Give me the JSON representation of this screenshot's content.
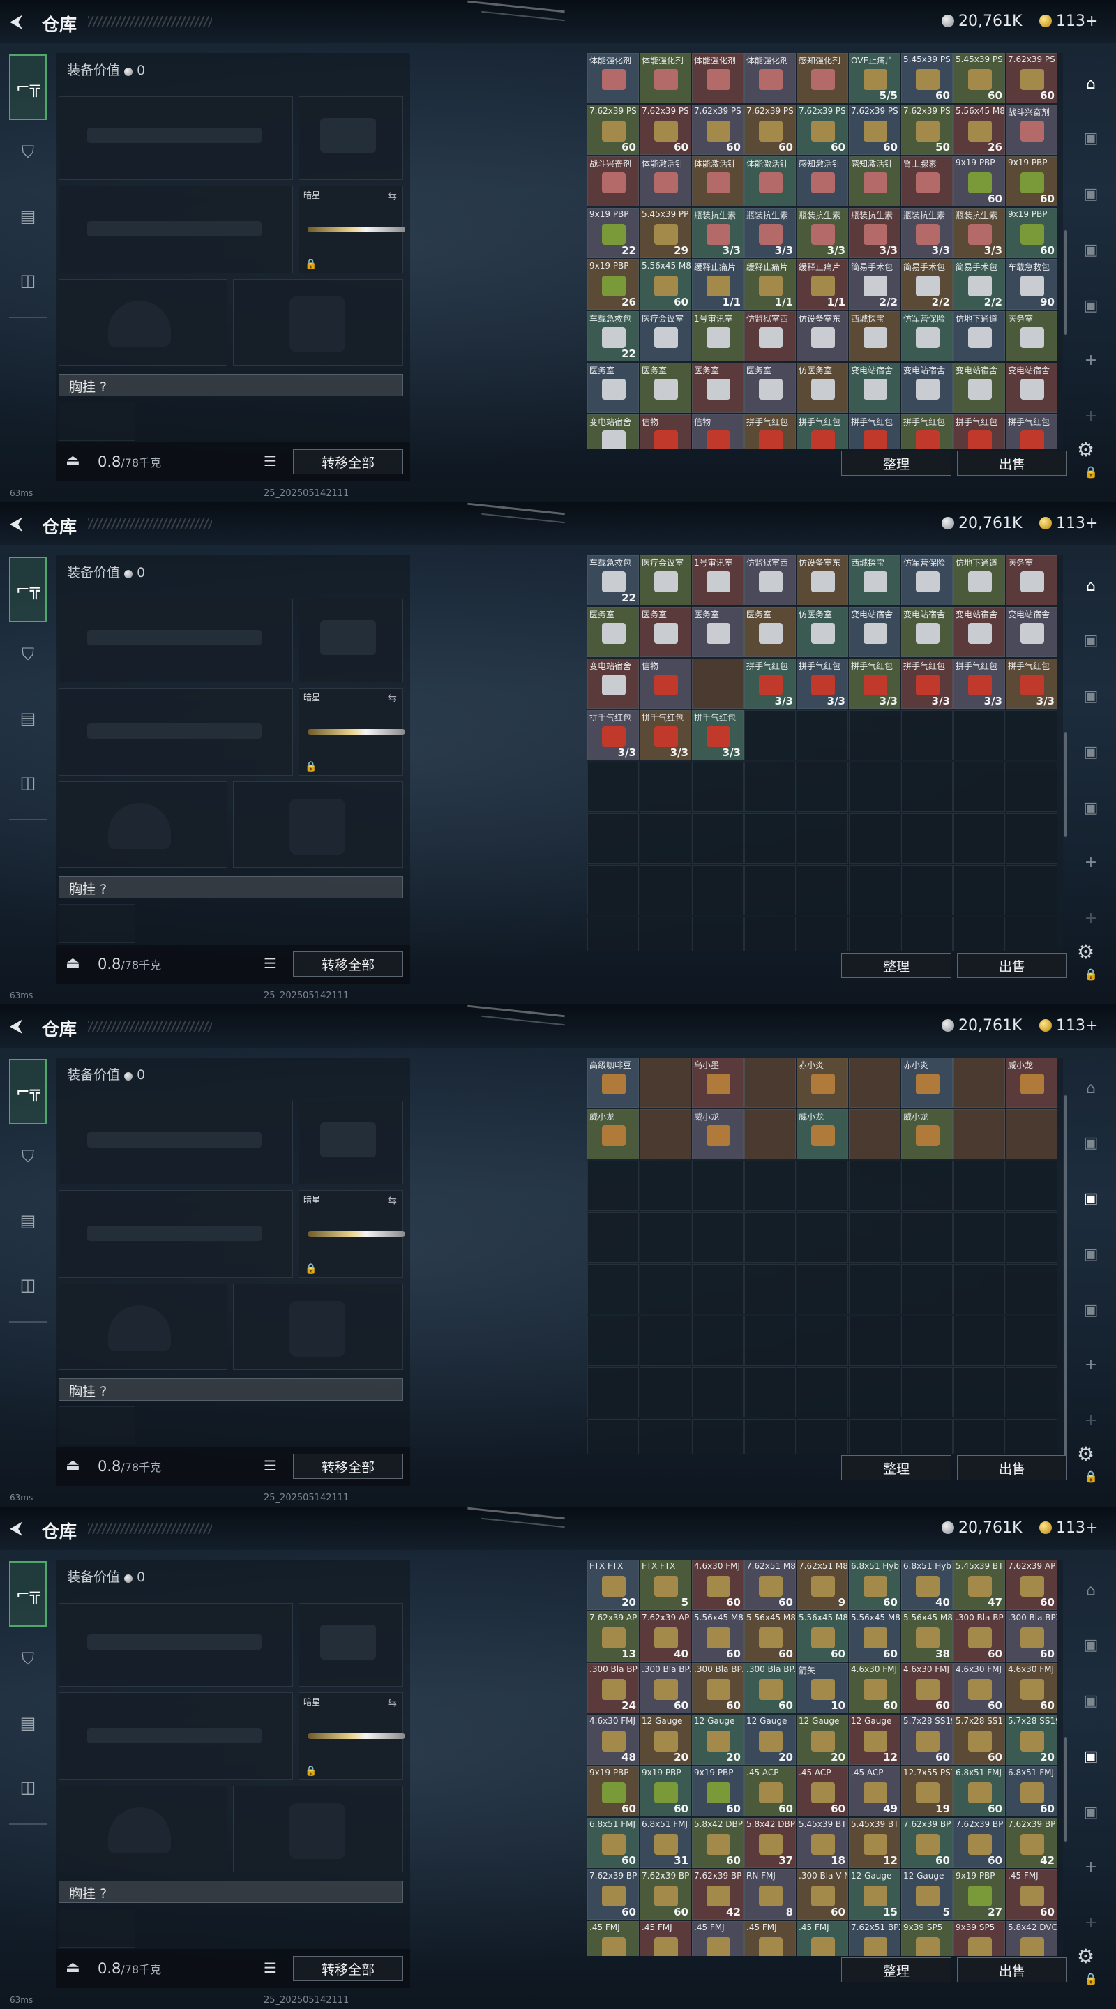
{
  "header": {
    "back": "⮜",
    "title": "仓库",
    "silver_amount": "20,761K",
    "gold_amount": "113+"
  },
  "equipment": {
    "value_label": "装备价值",
    "value": "0",
    "secondary_slot_label": "暗星",
    "vest_label": "胸挂 ?",
    "weight_current": "0.8",
    "weight_max": "/78千克",
    "transfer_all": "转移全部"
  },
  "stash_buttons": {
    "sort": "整理",
    "sell": "出售"
  },
  "status": {
    "ping": "63ms",
    "version": "25_202505142111"
  },
  "left_nav": [
    {
      "icon": "gun-icon"
    },
    {
      "icon": "armor-icon"
    },
    {
      "icon": "backpack-icon"
    },
    {
      "icon": "briefcase-icon"
    }
  ],
  "right_nav": [
    {
      "icon": "warehouse-icon"
    },
    {
      "icon": "tv-icon-1"
    },
    {
      "icon": "tv-icon-2"
    },
    {
      "icon": "tv-icon-3"
    },
    {
      "icon": "tv-icon-4"
    },
    {
      "icon": "plus-icon"
    },
    {
      "icon": "plus-icon-faint"
    },
    {
      "icon": "lock-icon"
    }
  ],
  "panels": [
    {
      "active_right": 0,
      "rows": [
        [
          [
            "体能强化剂",
            ""
          ],
          [
            "体能强化剂",
            ""
          ],
          [
            "体能强化剂",
            ""
          ],
          [
            "体能强化剂",
            ""
          ],
          [
            "感知强化剂",
            ""
          ],
          [
            "OVE止痛片",
            "5/5"
          ],
          [
            "5.45x39 PS",
            "60"
          ],
          [
            "5.45x39 PS",
            "60"
          ],
          [
            "7.62x39 PS",
            "60"
          ]
        ],
        [
          [
            "7.62x39 PS",
            "60"
          ],
          [
            "7.62x39 PS",
            "60"
          ],
          [
            "7.62x39 PS",
            "60"
          ],
          [
            "7.62x39 PS",
            "60"
          ],
          [
            "7.62x39 PS",
            "60"
          ],
          [
            "7.62x39 PS",
            "60"
          ],
          [
            "7.62x39 PS",
            "50"
          ],
          [
            "5.56x45 M855",
            "26"
          ],
          [
            "战斗兴奋剂",
            ""
          ]
        ],
        [
          [
            "战斗兴奋剂",
            ""
          ],
          [
            "体能激活针",
            ""
          ],
          [
            "体能激活针",
            ""
          ],
          [
            "体能激活针",
            ""
          ],
          [
            "感知激活针",
            ""
          ],
          [
            "感知激活针",
            ""
          ],
          [
            "肾上腺素",
            ""
          ],
          [
            "9x19 PBP",
            "60"
          ],
          [
            "9x19 PBP",
            "60"
          ]
        ],
        [
          [
            "9x19 PBP",
            "22"
          ],
          [
            "5.45x39 PP",
            "29"
          ],
          [
            "瓶装抗生素",
            "3/3"
          ],
          [
            "瓶装抗生素",
            "3/3"
          ],
          [
            "瓶装抗生素",
            "3/3"
          ],
          [
            "瓶装抗生素",
            "3/3"
          ],
          [
            "瓶装抗生素",
            "3/3"
          ],
          [
            "瓶装抗生素",
            "3/3"
          ],
          [
            "9x19 PBP",
            "60"
          ]
        ],
        [
          [
            "9x19 PBP",
            "26"
          ],
          [
            "5.56x45 M856",
            "60"
          ],
          [
            "缓释止痛片",
            "1/1"
          ],
          [
            "缓释止痛片",
            "1/1"
          ],
          [
            "缓释止痛片",
            "1/1"
          ],
          [
            "简易手术包",
            "2/2"
          ],
          [
            "简易手术包",
            "2/2"
          ],
          [
            "简易手术包",
            "2/2"
          ],
          [
            "车载急救包",
            "90"
          ]
        ],
        [
          [
            "车载急救包",
            "22"
          ],
          [
            "医疗会议室",
            ""
          ],
          [
            "1号审讯室",
            ""
          ],
          [
            "仿监狱室西",
            ""
          ],
          [
            "仿设备室东",
            ""
          ],
          [
            "西城探宝",
            ""
          ],
          [
            "仿军营保险",
            ""
          ],
          [
            "仿地下通道",
            ""
          ],
          [
            "医务室",
            ""
          ]
        ],
        [
          [
            "医务室",
            ""
          ],
          [
            "医务室",
            ""
          ],
          [
            "医务室",
            ""
          ],
          [
            "医务室",
            ""
          ],
          [
            "仿医务室",
            ""
          ],
          [
            "变电站宿舍",
            ""
          ],
          [
            "变电站宿舍",
            ""
          ],
          [
            "变电站宿舍",
            ""
          ],
          [
            "变电站宿舍",
            ""
          ]
        ],
        [
          [
            "变电站宿舍",
            ""
          ],
          [
            "信物",
            ""
          ],
          [
            "信物",
            ""
          ],
          [
            "拼手气红包",
            ""
          ],
          [
            "拼手气红包",
            ""
          ],
          [
            "拼手气红包",
            ""
          ],
          [
            "拼手气红包",
            ""
          ],
          [
            "拼手气红包",
            ""
          ],
          [
            "拼手气红包",
            ""
          ]
        ]
      ]
    },
    {
      "active_right": 0,
      "rows": [
        [
          [
            "车载急救包",
            "22"
          ],
          [
            "医疗会议室",
            ""
          ],
          [
            "1号审讯室",
            ""
          ],
          [
            "仿监狱室西",
            ""
          ],
          [
            "仿设备室东",
            ""
          ],
          [
            "西城探宝",
            ""
          ],
          [
            "仿军营保险",
            ""
          ],
          [
            "仿地下通道",
            ""
          ],
          [
            "医务室",
            ""
          ]
        ],
        [
          [
            "医务室",
            ""
          ],
          [
            "医务室",
            ""
          ],
          [
            "医务室",
            ""
          ],
          [
            "医务室",
            ""
          ],
          [
            "仿医务室",
            ""
          ],
          [
            "变电站宿舍",
            ""
          ],
          [
            "变电站宿舍",
            ""
          ],
          [
            "变电站宿舍",
            ""
          ],
          [
            "变电站宿舍",
            ""
          ]
        ],
        [
          [
            "变电站宿舍",
            ""
          ],
          [
            "信物",
            ""
          ],
          [
            "",
            ""
          ],
          [
            "拼手气红包",
            "3/3"
          ],
          [
            "拼手气红包",
            "3/3"
          ],
          [
            "拼手气红包",
            "3/3"
          ],
          [
            "拼手气红包",
            "3/3"
          ],
          [
            "拼手气红包",
            "3/3"
          ],
          [
            "拼手气红包",
            "3/3"
          ]
        ],
        [
          [
            "拼手气红包",
            "3/3"
          ],
          [
            "拼手气红包",
            "3/3"
          ],
          [
            "拼手气红包",
            "3/3"
          ]
        ]
      ]
    },
    {
      "active_right": 2,
      "rows": [
        [
          [
            "高级咖啡豆",
            ""
          ],
          [
            "",
            ""
          ],
          [
            "乌小墨",
            ""
          ],
          [
            "",
            ""
          ],
          [
            "赤小炎",
            ""
          ],
          [
            "",
            ""
          ],
          [
            "赤小炎",
            ""
          ],
          [
            "",
            ""
          ],
          [
            "威小龙",
            ""
          ]
        ],
        [
          [
            "威小龙",
            ""
          ],
          [
            "",
            ""
          ],
          [
            "威小龙",
            ""
          ],
          [
            "",
            ""
          ],
          [
            "威小龙",
            ""
          ],
          [
            "",
            ""
          ],
          [
            "威小龙",
            ""
          ],
          [
            "",
            ""
          ],
          [
            "",
            ""
          ]
        ]
      ]
    },
    {
      "active_right": 3,
      "rows": [
        [
          [
            "FTX FTX",
            "20"
          ],
          [
            "FTX FTX",
            "5"
          ],
          [
            "4.6x30 FMJ",
            "60"
          ],
          [
            "7.62x51 M80",
            "60"
          ],
          [
            "7.62x51 M80",
            "9"
          ],
          [
            "6.8x51 Hybrid",
            "60"
          ],
          [
            "6.8x51 Hybrid",
            "40"
          ],
          [
            "5.45x39 BT",
            "47"
          ],
          [
            "7.62x39 AP",
            "60"
          ]
        ],
        [
          [
            "7.62x39 AP",
            "13"
          ],
          [
            "7.62x39 AP",
            "40"
          ],
          [
            "5.56x45 M855",
            "60"
          ],
          [
            "5.56x45 M855",
            "60"
          ],
          [
            "5.56x45 M855",
            "60"
          ],
          [
            "5.56x45 M855",
            "60"
          ],
          [
            "5.56x45 M855",
            "38"
          ],
          [
            ".300 Bla BPZ",
            "60"
          ],
          [
            ".300 Bla BPZ",
            "60"
          ]
        ],
        [
          [
            ".300 Bla BPZ",
            "24"
          ],
          [
            ".300 Bla BPZ",
            "60"
          ],
          [
            ".300 Bla BPZ",
            "60"
          ],
          [
            ".300 Bla BPZ",
            "60"
          ],
          [
            "箭矢",
            "10"
          ],
          [
            "4.6x30 FMJ",
            "60"
          ],
          [
            "4.6x30 FMJ",
            "60"
          ],
          [
            "4.6x30 FMJ",
            "60"
          ],
          [
            "4.6x30 FMJ",
            "60"
          ]
        ],
        [
          [
            "4.6x30 FMJ",
            "48"
          ],
          [
            "12 Gauge",
            "20"
          ],
          [
            "12 Gauge",
            "20"
          ],
          [
            "12 Gauge",
            "20"
          ],
          [
            "12 Gauge",
            "20"
          ],
          [
            "12 Gauge",
            "12"
          ],
          [
            "5.7x28 SS190",
            "60"
          ],
          [
            "5.7x28 SS190",
            "60"
          ],
          [
            "5.7x28 SS190",
            "20"
          ]
        ],
        [
          [
            "9x19 PBP",
            "60"
          ],
          [
            "9x19 PBP",
            "60"
          ],
          [
            "9x19 PBP",
            "60"
          ],
          [
            ".45 ACP",
            "60"
          ],
          [
            ".45 ACP",
            "60"
          ],
          [
            ".45 ACP",
            "49"
          ],
          [
            "12.7x55 PS12",
            "19"
          ],
          [
            "6.8x51 FMJ",
            "60"
          ],
          [
            "6.8x51 FMJ",
            "60"
          ]
        ],
        [
          [
            "6.8x51 FMJ",
            "60"
          ],
          [
            "6.8x51 FMJ",
            "31"
          ],
          [
            "5.8x42 DBP10",
            "60"
          ],
          [
            "5.8x42 DBP10",
            "37"
          ],
          [
            "5.45x39 BT",
            "18"
          ],
          [
            "5.45x39 BT",
            "12"
          ],
          [
            "7.62x39 BP",
            "60"
          ],
          [
            "7.62x39 BP",
            "60"
          ],
          [
            "7.62x39 BP",
            "42"
          ]
        ],
        [
          [
            "7.62x39 BP",
            "60"
          ],
          [
            "7.62x39 BP",
            "60"
          ],
          [
            "7.62x39 BP",
            "42"
          ],
          [
            "RN FMJ",
            "8"
          ],
          [
            ".300 Bla V-Max",
            "60"
          ],
          [
            "12 Gauge",
            "15"
          ],
          [
            "12 Gauge",
            "5"
          ],
          [
            "9x19 PBP",
            "27"
          ],
          [
            ".45 FMJ",
            "60"
          ]
        ],
        [
          [
            ".45 FMJ",
            ""
          ],
          [
            ".45 FMJ",
            ""
          ],
          [
            ".45 FMJ",
            ""
          ],
          [
            ".45 FMJ",
            ""
          ],
          [
            ".45 FMJ",
            ""
          ],
          [
            "7.62x51 BPZ",
            ""
          ],
          [
            "9x39 SP5",
            ""
          ],
          [
            "9x39 SP5",
            ""
          ],
          [
            "5.8x42 DVC12",
            ""
          ]
        ]
      ]
    }
  ]
}
